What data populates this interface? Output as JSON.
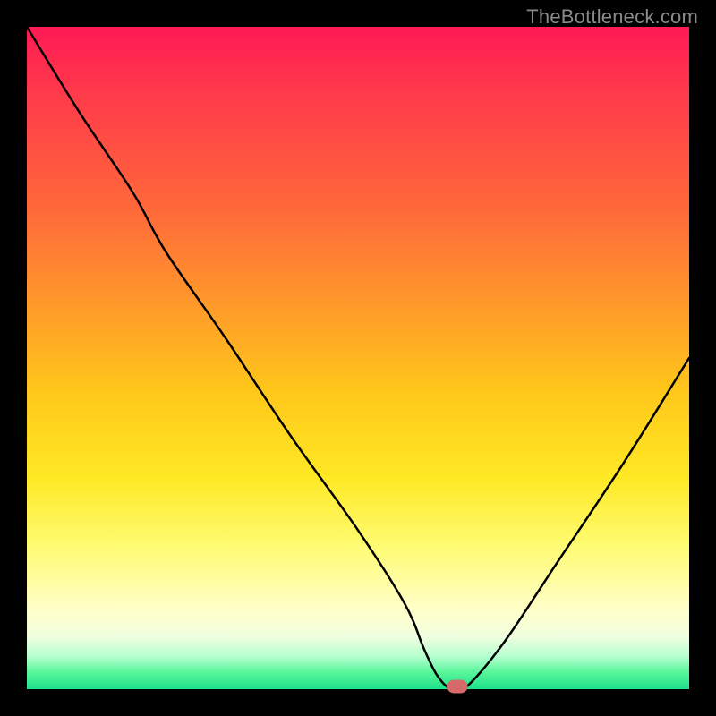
{
  "watermark": "TheBottleneck.com",
  "chart_data": {
    "type": "line",
    "title": "",
    "xlabel": "",
    "ylabel": "",
    "xlim": [
      0,
      100
    ],
    "ylim": [
      0,
      100
    ],
    "series": [
      {
        "name": "bottleneck-curve",
        "x": [
          0,
          8,
          16,
          21,
          30,
          40,
          50,
          57,
          60,
          62,
          64,
          66,
          72,
          80,
          90,
          100
        ],
        "y": [
          100,
          87,
          75,
          66,
          53,
          38,
          24,
          13,
          6,
          2,
          0,
          0,
          7,
          19,
          34,
          50
        ]
      }
    ],
    "marker": {
      "x": 65,
      "y": 0,
      "color": "#d56a6a"
    },
    "gradient_stops": [
      {
        "pos": 0,
        "color": "#ff1a55"
      },
      {
        "pos": 28,
        "color": "#ff6a3a"
      },
      {
        "pos": 55,
        "color": "#ffc71a"
      },
      {
        "pos": 78,
        "color": "#fffb70"
      },
      {
        "pos": 97,
        "color": "#57f59a"
      },
      {
        "pos": 100,
        "color": "#1de28a"
      }
    ]
  }
}
